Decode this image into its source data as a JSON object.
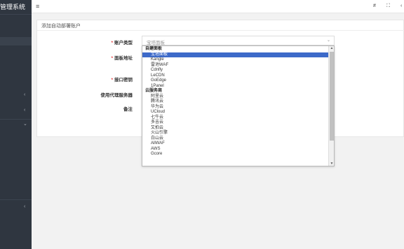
{
  "app": {
    "title": "管理系统"
  },
  "sidebar": {
    "chevrons": [
      "‹",
      "‹",
      "⌄",
      "‹"
    ]
  },
  "topbar": {
    "menu_icon": "≡",
    "icons": [
      "#",
      "⛶",
      "‹"
    ]
  },
  "card": {
    "title": "添加自动部署账户"
  },
  "form": {
    "account_type_label": "账户类型",
    "panel_address_label": "面板地址",
    "api_key_label": "接口密钥",
    "use_proxy_label": "使用代理服务器",
    "remark_label": "备注",
    "account_type_value": "宝塔面板"
  },
  "dropdown": {
    "items": [
      {
        "type": "group",
        "label": "自建面板"
      },
      {
        "type": "option",
        "label": "宝塔面板",
        "selected": true
      },
      {
        "type": "option",
        "label": "Kangle"
      },
      {
        "type": "option",
        "label": "雷池WAF"
      },
      {
        "type": "option",
        "label": "Cdnfly"
      },
      {
        "type": "option",
        "label": "LeCDN"
      },
      {
        "type": "option",
        "label": "GoEdge"
      },
      {
        "type": "option",
        "label": "1Panel"
      },
      {
        "type": "group",
        "label": "云服务商"
      },
      {
        "type": "option",
        "label": "阿里云"
      },
      {
        "type": "option",
        "label": "腾讯云"
      },
      {
        "type": "option",
        "label": "华为云"
      },
      {
        "type": "option",
        "label": "UCloud"
      },
      {
        "type": "option",
        "label": "七牛云"
      },
      {
        "type": "option",
        "label": "多吉云"
      },
      {
        "type": "option",
        "label": "又拍云"
      },
      {
        "type": "option",
        "label": "火山引擎"
      },
      {
        "type": "option",
        "label": "白山云"
      },
      {
        "type": "option",
        "label": "AllWAF"
      },
      {
        "type": "option",
        "label": "AWS"
      },
      {
        "type": "option",
        "label": "Gcore"
      }
    ]
  }
}
